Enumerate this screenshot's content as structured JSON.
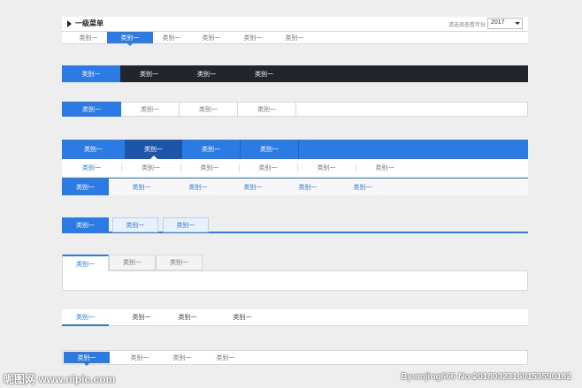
{
  "colors": {
    "blue": "#2c7be5",
    "dark": "#22252b",
    "active_dark": "#1d56a8",
    "pale": "#e9f1fc"
  },
  "tab_label": "类别一",
  "header": {
    "title": "一级菜单",
    "year_label": "请选择查看年份",
    "year_value": "2017"
  },
  "watermark": {
    "brand": "昵图网 www.nipic.com",
    "credit": "By:anjing666 No:20180323160153590182"
  }
}
